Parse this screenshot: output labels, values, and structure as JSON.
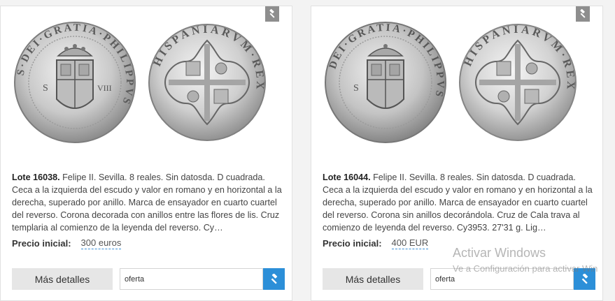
{
  "lots": [
    {
      "lot_label": "Lote 16038.",
      "description": " Felipe II. Sevilla. 8 reales. Sin datosda. D cuadrada. Ceca a la izquierda del escudo y valor en romano y en horizontal a la derecha, superado por anillo. Marca de ensayador en cuarto cuartel del reverso. Corona decorada con anillos entre las flores de lis. Cruz templaria al comienzo de la leyenda del reverso. Cy…",
      "price_label": "Precio inicial:",
      "price_value": "300 euros",
      "details_label": "Más detalles",
      "bid_value": "oferta",
      "obverse_legend": "S·DEI·GRATIA·PHILIPPVS",
      "reverse_legend": "HISPANIARVM·REX"
    },
    {
      "lot_label": "Lote 16044.",
      "description": " Felipe II. Sevilla. 8 reales. Sin datosda. D cuadrada. Ceca a la izquierda del escudo y valor en romano y en horizontal a la derecha, superado por anillo. Marca de ensayador en cuarto cuartel del reverso. Corona sin anillos decorándola. Cruz de Cala trava al comienzo de leyenda del reverso. Cy3953. 27'31 g. Lig…",
      "price_label": "Precio inicial:",
      "price_value": "400 EUR",
      "details_label": "Más detalles",
      "bid_value": "oferta",
      "obverse_legend": "DEI·GRATIA·PHILIPPVS",
      "reverse_legend": "HISPANIARVM·REX"
    }
  ],
  "watermark": {
    "title": "Activar Windows",
    "subtitle": "Ve a Configuración para activar Win"
  },
  "colors": {
    "accent": "#2c8fd8",
    "corner_icon": "#8e8e8e",
    "button_bg": "#e6e6e6"
  },
  "icons": {
    "corner": "gavel-icon",
    "bid": "gavel-icon"
  }
}
